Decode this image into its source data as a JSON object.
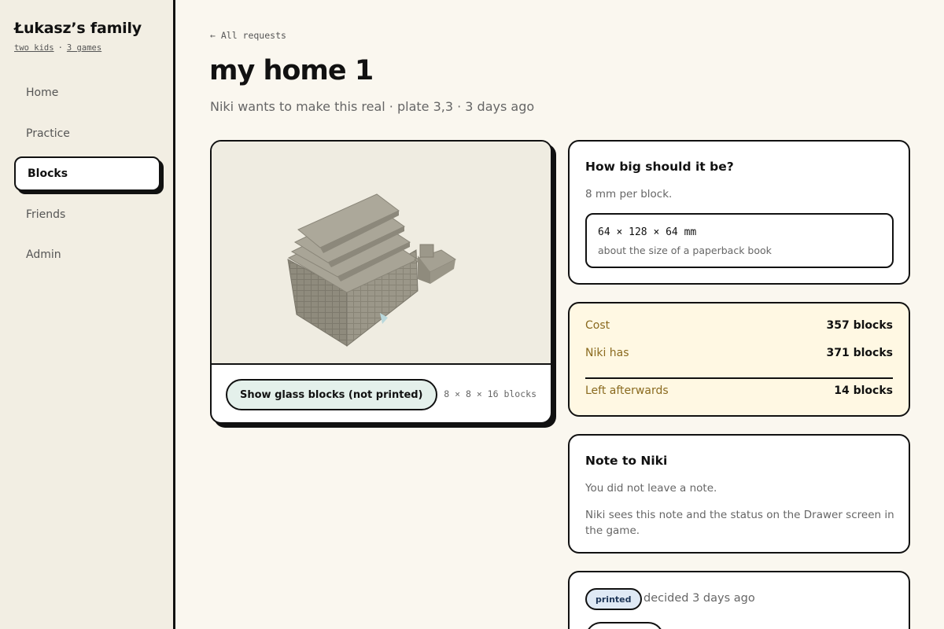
{
  "sidebar": {
    "family_title": "Łukasz’s family",
    "kids_link": "two kids",
    "separator": "·",
    "games_link": "3 games",
    "items": [
      {
        "label": "Home"
      },
      {
        "label": "Practice"
      },
      {
        "label": "Blocks",
        "active": true
      },
      {
        "label": "Friends"
      },
      {
        "label": "Admin"
      }
    ]
  },
  "header": {
    "back_label": "← All requests",
    "title": "my home 1",
    "subtitle": "Niki wants to make this real · plate 3,3 · 3 days ago"
  },
  "preview": {
    "glass_button": "Show glass blocks (not printed)",
    "dimensions": "8 × 8 × 16 blocks"
  },
  "size": {
    "title": "How big should it be?",
    "per_block": "8 mm per block.",
    "mm": "64 × 128 × 64 mm",
    "comparison": "about the size of a paperback book"
  },
  "cost": {
    "cost_label": "Cost",
    "cost_value": "357 blocks",
    "has_label": "Niki has",
    "has_value": "371 blocks",
    "left_label": "Left afterwards",
    "left_value": "14 blocks"
  },
  "note": {
    "title": "Note to Niki",
    "empty": "You did not leave a note.",
    "info": "Niki sees this note and the status on the Drawer screen in the game."
  },
  "status": {
    "badge": "printed",
    "decided": "decided 3 days ago"
  },
  "colors": {
    "background": "#faf7ef",
    "sidebar": "#f2eee3",
    "cost_card": "#fff8e3",
    "glass_button": "#e4f0eb",
    "badge": "#dfe9f5"
  }
}
